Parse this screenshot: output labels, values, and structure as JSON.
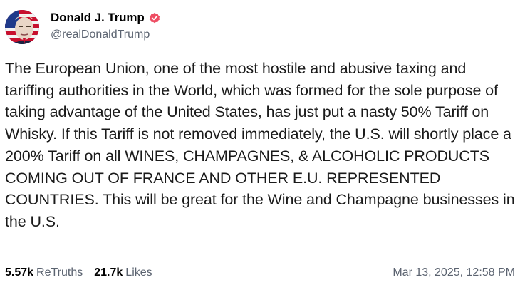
{
  "post": {
    "author": {
      "display_name": "Donald J. Trump",
      "handle": "@realDonaldTrump",
      "verified": true,
      "verified_color": "#ee4d63"
    },
    "text": "The European Union, one of the most hostile and abusive taxing and tariffing authorities in the World, which was formed for the sole purpose of taking advantage of the United States, has just put a nasty 50% Tariff on Whisky. If this Tariff is not removed immediately, the U.S. will shortly place a 200% Tariff on all WINES, CHAMPAGNES, & ALCOHOLIC PRODUCTS COMING OUT OF FRANCE AND OTHER E.U. REPRESENTED COUNTRIES. This will be great for the Wine and Champagne businesses in the U.S.",
    "retruths": {
      "count": "5.57k",
      "label": "ReTruths"
    },
    "likes": {
      "count": "21.7k",
      "label": "Likes"
    },
    "timestamp": "Mar 13, 2025, 12:58 PM"
  }
}
